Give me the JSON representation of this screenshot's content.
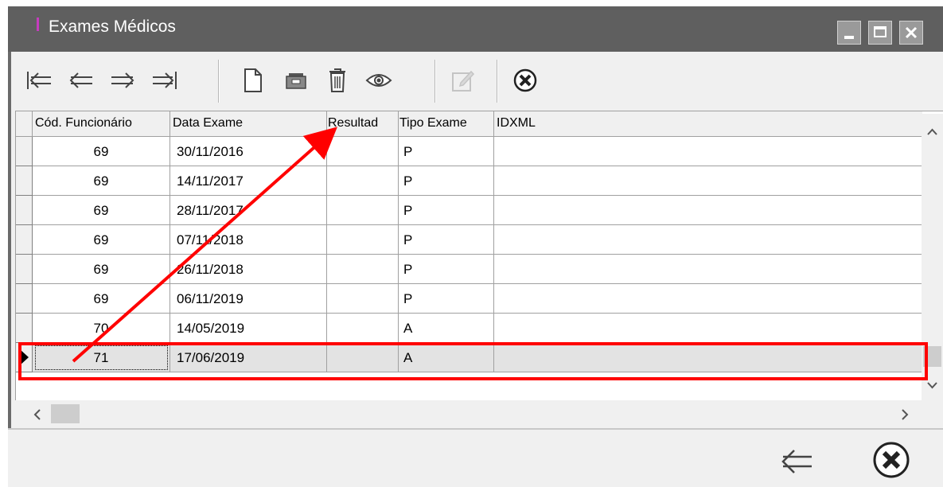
{
  "window": {
    "title": "Exames Médicos"
  },
  "toolbar": {
    "buttons": [
      {
        "name": "first-record",
        "icon": "first-record-icon"
      },
      {
        "name": "prior-record",
        "icon": "prior-arrow-icon"
      },
      {
        "name": "next-record",
        "icon": "next-arrow-icon"
      },
      {
        "name": "last-record",
        "icon": "last-record-icon"
      },
      {
        "name": "new-record",
        "icon": "new-document-icon"
      },
      {
        "name": "edit-record",
        "icon": "edit-record-icon"
      },
      {
        "name": "delete-record",
        "icon": "trash-icon"
      },
      {
        "name": "view-record",
        "icon": "eye-icon"
      },
      {
        "name": "post-edit",
        "icon": "pencil-icon",
        "disabled": true
      },
      {
        "name": "cancel",
        "icon": "cancel-x-icon"
      }
    ]
  },
  "grid": {
    "columns": [
      "Cód. Funcionário",
      "Data Exame",
      "Resultad",
      "Tipo Exame",
      "IDXML"
    ],
    "rows": [
      {
        "cod": "69",
        "data": "30/11/2016",
        "resultado": "",
        "tipo": "P",
        "idxml": ""
      },
      {
        "cod": "69",
        "data": "14/11/2017",
        "resultado": "",
        "tipo": "P",
        "idxml": ""
      },
      {
        "cod": "69",
        "data": "28/11/2017",
        "resultado": "",
        "tipo": "P",
        "idxml": ""
      },
      {
        "cod": "69",
        "data": "07/11/2018",
        "resultado": "",
        "tipo": "P",
        "idxml": ""
      },
      {
        "cod": "69",
        "data": "26/11/2018",
        "resultado": "",
        "tipo": "P",
        "idxml": ""
      },
      {
        "cod": "69",
        "data": "06/11/2019",
        "resultado": "",
        "tipo": "P",
        "idxml": ""
      },
      {
        "cod": "70",
        "data": "14/05/2019",
        "resultado": "",
        "tipo": "A",
        "idxml": ""
      },
      {
        "cod": "71",
        "data": "17/06/2019",
        "resultado": "",
        "tipo": "A",
        "idxml": ""
      }
    ],
    "selected_row": 8
  },
  "bottom": {
    "back_icon": "back-arrow-icon",
    "close_icon": "close-circle-x-icon"
  },
  "annotation": {
    "color": "#ff0000"
  }
}
